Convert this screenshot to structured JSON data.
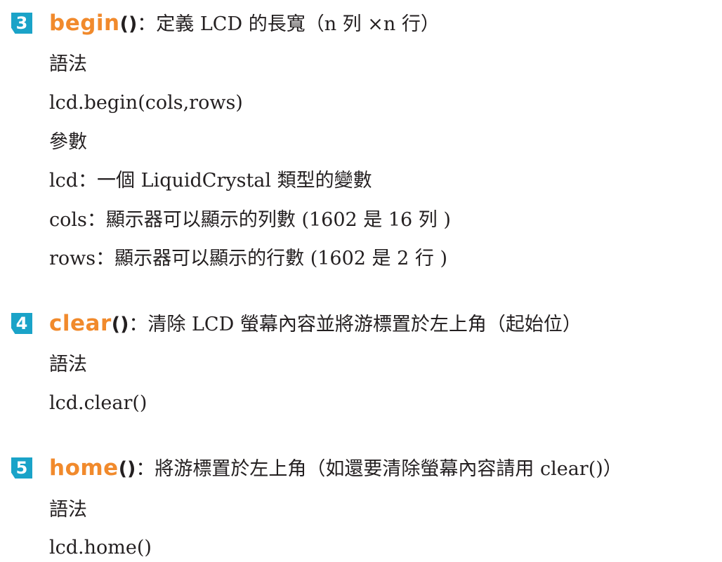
{
  "sections": [
    {
      "number": "3",
      "func_name": "begin",
      "parens": "()",
      "description": "：定義 LCD 的長寬（n 列 ×n 行）",
      "lines": [
        "語法",
        "lcd.begin(cols,rows)",
        "參數",
        "lcd：一個 LiquidCrystal 類型的變數",
        "cols：顯示器可以顯示的列數 (1602 是 16 列 )",
        "rows：顯示器可以顯示的行數 (1602 是 2 行 )"
      ]
    },
    {
      "number": "4",
      "func_name": "clear",
      "parens": "()",
      "description": "：清除 LCD 螢幕內容並將游標置於左上角（起始位）",
      "lines": [
        "語法",
        "lcd.clear()"
      ]
    },
    {
      "number": "5",
      "func_name": "home",
      "parens": "()",
      "description": "：將游標置於左上角（如還要清除螢幕內容請用 clear()）",
      "lines": [
        "語法",
        "lcd.home()"
      ]
    }
  ]
}
